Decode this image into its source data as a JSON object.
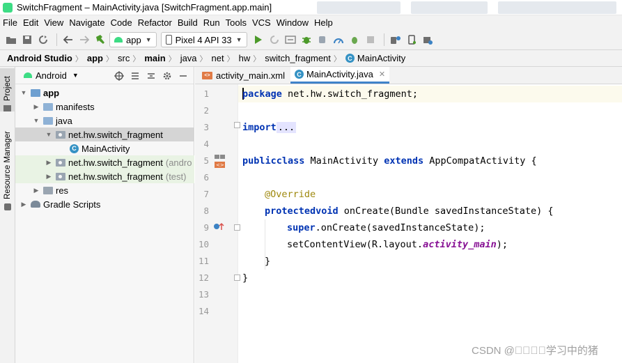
{
  "window": {
    "title": "SwitchFragment – MainActivity.java [SwitchFragment.app.main]"
  },
  "menu": [
    "File",
    "Edit",
    "View",
    "Navigate",
    "Code",
    "Refactor",
    "Build",
    "Run",
    "Tools",
    "VCS",
    "Window",
    "Help"
  ],
  "toolbar": {
    "run_config": "app",
    "device": "Pixel 4 API 33"
  },
  "breadcrumb": [
    "Android Studio",
    "app",
    "src",
    "main",
    "java",
    "net",
    "hw",
    "switch_fragment",
    "MainActivity"
  ],
  "left_tabs": [
    "Project",
    "Resource Manager"
  ],
  "project_panel": {
    "view_mode": "Android",
    "tree": [
      {
        "label": "app",
        "bold": true
      },
      {
        "label": "manifests"
      },
      {
        "label": "java"
      },
      {
        "label": "net.hw.switch_fragment"
      },
      {
        "label": "MainActivity"
      },
      {
        "label": "net.hw.switch_fragment",
        "suffix": "(andro"
      },
      {
        "label": "net.hw.switch_fragment",
        "suffix": "(test)"
      },
      {
        "label": "res"
      },
      {
        "label": "Gradle Scripts"
      }
    ]
  },
  "editor": {
    "tabs": [
      {
        "label": "activity_main.xml",
        "icon": "xml-file-icon"
      },
      {
        "label": "MainActivity.java",
        "icon": "java-class-icon",
        "active": true
      }
    ],
    "line_numbers": [
      "1",
      "2",
      "3",
      "4",
      "5",
      "6",
      "7",
      "8",
      "9",
      "10",
      "11",
      "12",
      "13",
      "14"
    ],
    "code": {
      "l1_kw": "package",
      "l1_rest": " net.hw.switch_fragment;",
      "l3_kw": "import",
      "l3_dots": "...",
      "l7_kw1": "public",
      "l7_kw2": "class",
      "l7_name": " MainActivity ",
      "l7_kw3": "extends",
      "l7_rest": " AppCompatActivity {",
      "l9_ann": "@Override",
      "l10_kw1": "protected",
      "l10_kw2": "void",
      "l10_rest": " onCreate(Bundle savedInstanceState) {",
      "l11_kw": "super",
      "l11_rest": ".onCreate(savedInstanceState);",
      "l12_a": "setContentView(R.layout.",
      "l12_field": "activity_main",
      "l12_b": ");",
      "l13": "}",
      "l14": "}"
    }
  },
  "watermark": "CSDN @\u0000\u0000\u0000\u0000学习中的猪",
  "colors": {
    "keyword": "#0033b3",
    "annotation": "#9e880d",
    "field": "#871094",
    "accent": "#4083c9"
  }
}
